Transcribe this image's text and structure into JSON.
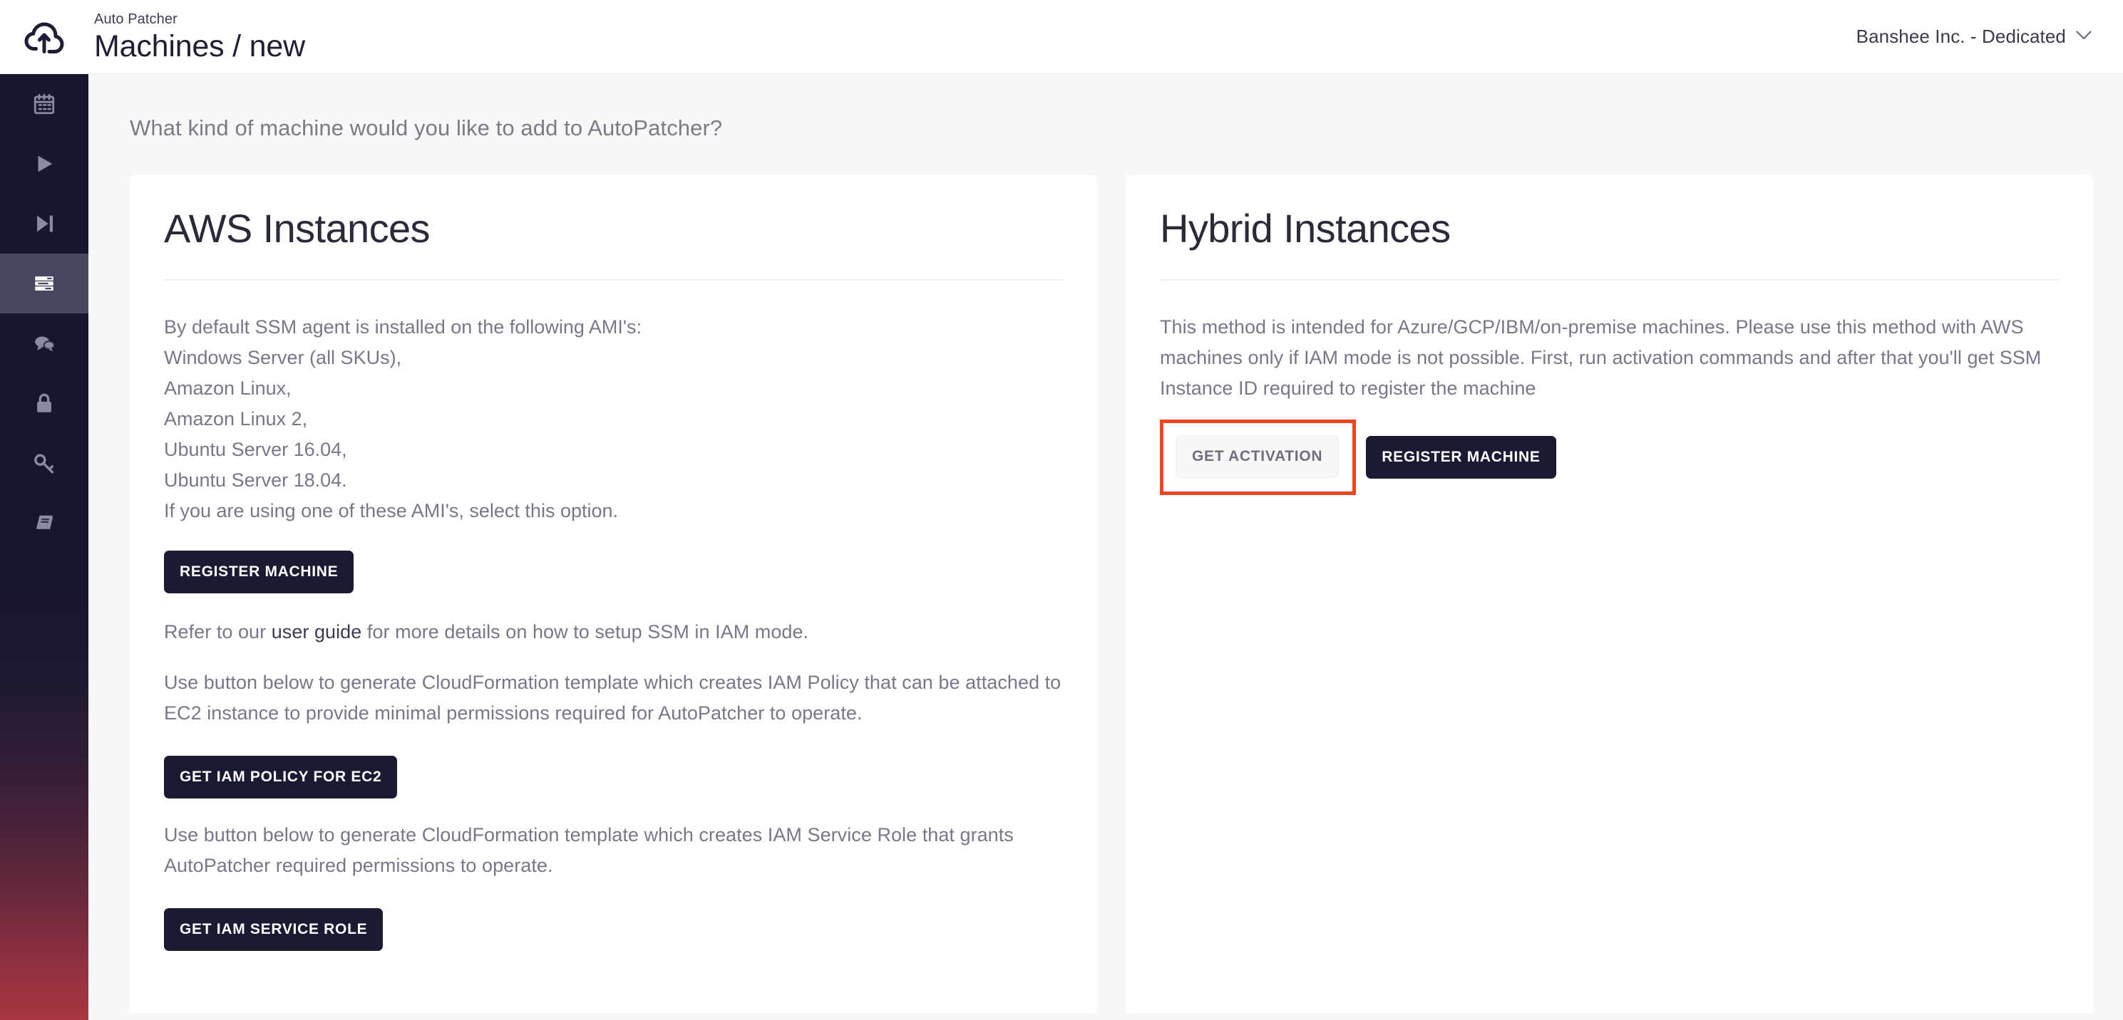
{
  "header": {
    "logo_icon": "cloud-upload-icon",
    "eyebrow": "Auto Patcher",
    "title": "Machines / new",
    "org": {
      "name": "Banshee Inc. - Dedicated",
      "chevron_icon": "chevron-down-icon"
    }
  },
  "sidebar": {
    "items": [
      {
        "icon": "calendar-icon",
        "active": false
      },
      {
        "icon": "play-icon",
        "active": false
      },
      {
        "icon": "skip-forward-icon",
        "active": false
      },
      {
        "icon": "server-list-icon",
        "active": true
      },
      {
        "icon": "chat-bubbles-icon",
        "active": false
      },
      {
        "icon": "lock-icon",
        "active": false
      },
      {
        "icon": "key-icon",
        "active": false
      },
      {
        "icon": "book-icon",
        "active": false
      }
    ]
  },
  "main": {
    "prompt": "What kind of machine would you like to add to AutoPatcher?",
    "cards": [
      {
        "title": "AWS Instances",
        "intro": "By default SSM agent is installed on the following AMI's:",
        "ami_list": [
          "Windows Server (all SKUs),",
          "Amazon Linux,",
          "Amazon Linux 2,",
          "Ubuntu Server 16.04,",
          "Ubuntu Server 18.04."
        ],
        "closing": "If you are using one of these AMI's, select this option.",
        "register_button": "REGISTER MACHINE",
        "guide_prefix": "Refer to our ",
        "guide_link": "user guide",
        "guide_suffix": " for more details on how to setup SSM in IAM mode.",
        "policy_text": "Use button below to generate CloudFormation template which creates IAM Policy that can be attached to EC2 instance to provide minimal permissions required for AutoPatcher to operate.",
        "policy_button": "GET IAM POLICY FOR EC2",
        "role_text": "Use button below to generate CloudFormation template which creates IAM Service Role that grants AutoPatcher required permissions to operate.",
        "role_button": "GET IAM SERVICE ROLE"
      },
      {
        "title": "Hybrid Instances",
        "description": "This method is intended for Azure/GCP/IBM/on-premise machines. Please use this method with AWS machines only if IAM mode is not possible. First, run activation commands and after that you'll get SSM Instance ID required to register the machine",
        "activation_button": "GET ACTIVATION",
        "register_button": "REGISTER MACHINE"
      }
    ]
  },
  "colors": {
    "sidebar_top": "#16162E",
    "sidebar_bottom": "#A7373F",
    "sidebar_active": "#474761",
    "button_dark": "#1A1A33",
    "highlight": "#F0441F",
    "page_bg": "#F7F8FA"
  }
}
